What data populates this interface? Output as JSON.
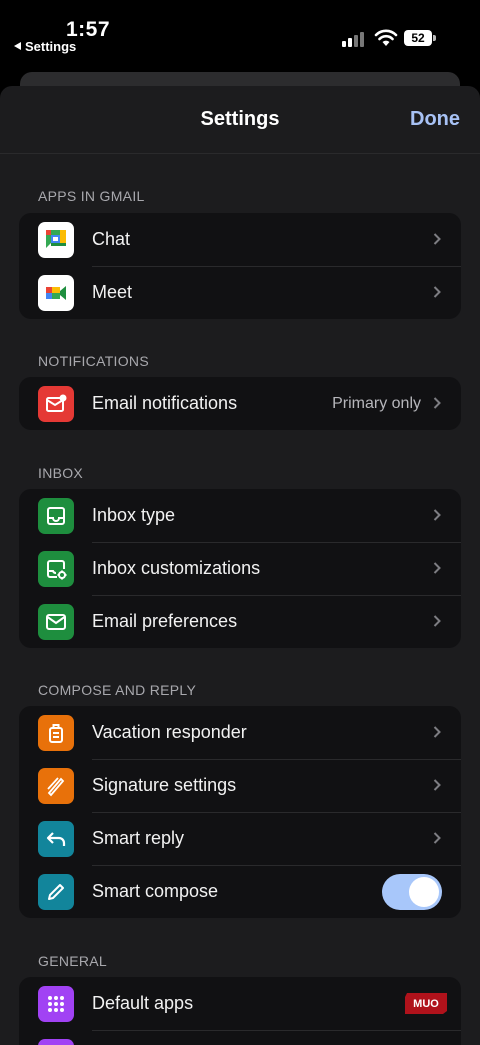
{
  "status_bar": {
    "time": "1:57",
    "back_app": "Settings",
    "battery": "52"
  },
  "nav": {
    "title": "Settings",
    "done": "Done"
  },
  "sections": {
    "apps": {
      "header": "APPS IN GMAIL",
      "chat": "Chat",
      "meet": "Meet"
    },
    "notifications": {
      "header": "NOTIFICATIONS",
      "email_notifications": "Email notifications",
      "email_notifications_value": "Primary only"
    },
    "inbox": {
      "header": "INBOX",
      "inbox_type": "Inbox type",
      "inbox_customizations": "Inbox customizations",
      "email_preferences": "Email preferences"
    },
    "compose": {
      "header": "COMPOSE AND REPLY",
      "vacation_responder": "Vacation responder",
      "signature_settings": "Signature settings",
      "smart_reply": "Smart reply",
      "smart_compose": "Smart compose",
      "smart_compose_enabled": true
    },
    "general": {
      "header": "GENERAL",
      "default_apps": "Default apps"
    }
  },
  "watermark": "MUO",
  "colors": {
    "accent": "#a8c2f5",
    "notification_red": "#e53935",
    "inbox_green": "#1e8e3e",
    "compose_orange": "#e8710a",
    "smart_teal": "#12859b",
    "general_purple": "#a142f4",
    "toggle_on": "#a8c7fa"
  }
}
